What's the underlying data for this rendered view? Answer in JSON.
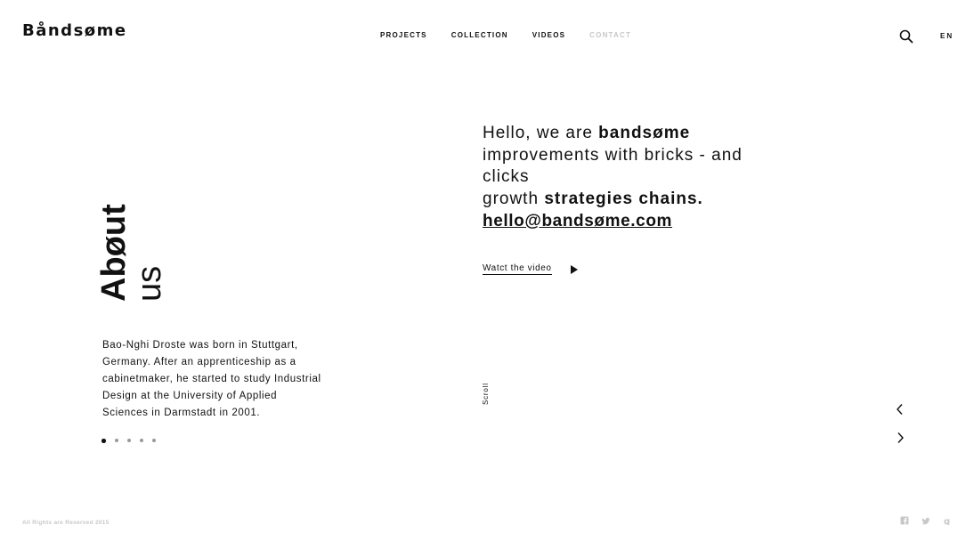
{
  "brand": {
    "logo": "Båndsøme"
  },
  "nav": {
    "items": [
      "PROJECTS",
      "COLLECTION",
      "VIDEOS",
      "CONTACT"
    ],
    "active": "CONTACT"
  },
  "header": {
    "lang": "EN"
  },
  "about": {
    "title_line1": "Abøut",
    "title_line2": "us",
    "bio": "Bao-Nghi Droste was born in Stuttgart, Germany. After an apprenticeship as a cabinetmaker, he started to study Industrial Design at the  University of Applied Sciences in Darmstadt in 2001.",
    "pager": {
      "count": 5,
      "active_index": 0
    }
  },
  "intro": {
    "line1_prefix": "Hello, we are ",
    "brand_name": "bandsøme",
    "line2": "improvements with bricks - and clicks",
    "line3_prefix": "growth ",
    "line3_bold": "strategies chains."
  },
  "contact": {
    "email": "hello@bandsøme.com"
  },
  "video": {
    "label": "Watct the video"
  },
  "scroll_label": "Scroll",
  "footer": {
    "copyright": "All Rights are Reserved 2015"
  },
  "icons": {
    "search": "search-icon",
    "play": "play-icon",
    "prev": "chevron-left-icon",
    "next": "chevron-right-icon",
    "facebook": "facebook-icon",
    "twitter": "twitter-icon",
    "googleplus": "google-plus-icon"
  },
  "colors": {
    "text": "#111111",
    "muted": "#c8c8c8",
    "dot_inactive": "#999999"
  }
}
